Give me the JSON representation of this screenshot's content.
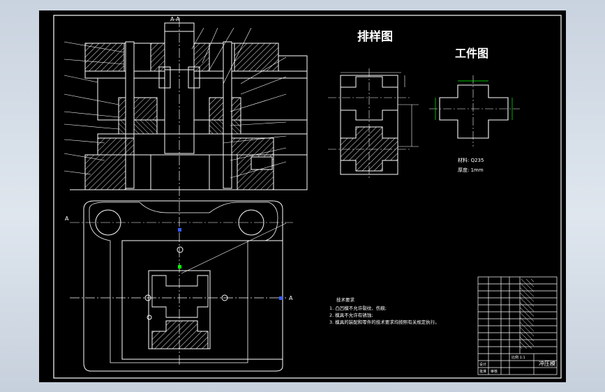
{
  "titles": {
    "layout": "排样图",
    "part": "工件图",
    "section_mark": "A-A",
    "view_mark_left": "A",
    "view_mark_right": "A"
  },
  "part_info": {
    "material": "材料: Q235",
    "thickness": "厚度: 1mm"
  },
  "tech_requirements": {
    "heading": "技术要求",
    "items": [
      "1. 凸凹模不允许裂纹、伤痕;",
      "2. 模具不允许有锈蚀;",
      "3. 模具的装配和零件的技术要求均按照有关规定执行。"
    ]
  },
  "title_block": {
    "drawing_name": "冲压模",
    "scale": "比例 1:1",
    "label_design": "设计",
    "label_check": "审核",
    "label_approve": "批准"
  },
  "colors": {
    "paper": "#000000",
    "line": "#ffffff",
    "hatch": "#ffffff",
    "dimension": "#00ff00",
    "center": "#ffffff",
    "mark_blue": "#3a5cff",
    "frame_bg": "#cfd8e3"
  }
}
